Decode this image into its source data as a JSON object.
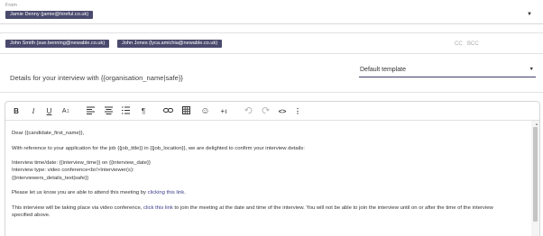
{
  "from": {
    "label": "From",
    "selected": "Jamie Denny (jamie@hireful.co.uk)"
  },
  "to": {
    "recipients": [
      "John Smith (sue.benning@newable.co.uk)",
      "John Jones (lyca.amichia@newable.co.uk)"
    ],
    "cc_label": "CC",
    "bcc_label": "BCC"
  },
  "details": {
    "text": "Details for your interview with {{organisation_name|safe}}",
    "template": "Default template"
  },
  "toolbar": {
    "bold": "B",
    "italic": "I",
    "underline": "U",
    "font_size": "A↕",
    "paragraph": "¶",
    "emoji": "☺",
    "insert": "+ı",
    "code": "<>",
    "more": "⋮"
  },
  "body": {
    "greeting": "Dear {{candidate_first_name}},",
    "line1": "With reference to your application for the job {{job_title}} in {{job_location}}, we are delighted to confirm your interview details:",
    "time": "Interview time/date: {{interview_time}} on {{interview_date}}",
    "type": "Interview type: video conference<br/>Interviewer(s):",
    "interviewers": "{{interviewers_details_text|safe}}",
    "attend_pre": "Please let us know you are able to attend this meeting by ",
    "attend_link": "clicking this link",
    "attend_post": ".",
    "video_pre": "This interview will be taking place via video conference, ",
    "video_link": "click this link",
    "video_post": " to join the meeting at the date and time of the interview. You will not be able to join the interview until on or after the time of the interview",
    "video_line2": "specified above."
  },
  "colors": {
    "chip": "#4a4a6e",
    "accent": "#3d3d6b",
    "link": "#3b3b8c"
  }
}
